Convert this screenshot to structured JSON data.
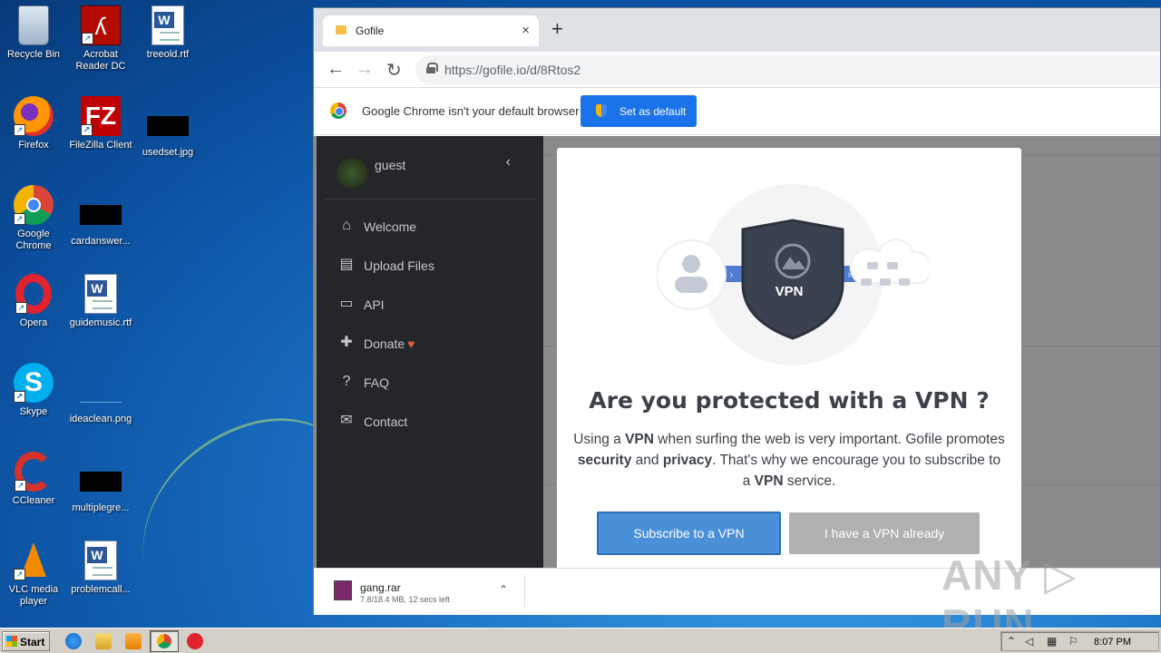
{
  "desktop": {
    "icons": [
      {
        "label": "Recycle Bin"
      },
      {
        "label": "Acrobat\nReader DC"
      },
      {
        "label": "treeold.rtf"
      },
      {
        "label": "Firefox"
      },
      {
        "label": "FileZilla Client"
      },
      {
        "label": "usedset.jpg"
      },
      {
        "label": "Google\nChrome"
      },
      {
        "label": "cardanswer..."
      },
      {
        "label": "Opera"
      },
      {
        "label": "guidemusic.rtf"
      },
      {
        "label": "Skype"
      },
      {
        "label": "ideaclean.png"
      },
      {
        "label": "CCleaner"
      },
      {
        "label": "multiplegre..."
      },
      {
        "label": "VLC media\nplayer"
      },
      {
        "label": "problemcall..."
      }
    ]
  },
  "browser": {
    "tab_title": "Gofile",
    "close_glyph": "×",
    "newtab_glyph": "+",
    "nav": {
      "back": "←",
      "forward": "→",
      "reload": "↻"
    },
    "url": "https://gofile.io/d/8Rtos2",
    "infobar": {
      "message": "Google Chrome isn't your default browser",
      "button": "Set as default"
    }
  },
  "gofile": {
    "user": {
      "name": "guest",
      "collapse_glyph": "‹"
    },
    "menu": [
      {
        "icon": "home-icon",
        "glyph": "⌂",
        "label": "Welcome"
      },
      {
        "icon": "upload-file-icon",
        "glyph": "▤",
        "label": "Upload Files"
      },
      {
        "icon": "api-icon",
        "glyph": "▭",
        "label": "API"
      },
      {
        "icon": "gift-icon",
        "glyph": "✚",
        "label": "Donate",
        "suffix": "♥"
      },
      {
        "icon": "question-icon",
        "glyph": "?",
        "label": "FAQ"
      },
      {
        "icon": "envelope-icon",
        "glyph": "✉",
        "label": "Contact"
      }
    ],
    "modal": {
      "shield_text": "VPN",
      "title": "Are you protected with a VPN ?",
      "desc_1": "Using a ",
      "desc_vpn": "VPN",
      "desc_2": " when surfing the web is very important. Gofile promotes ",
      "desc_security": "security",
      "desc_3": " and ",
      "desc_privacy": "privacy",
      "desc_4": ". That's why we encourage you to subscribe to a ",
      "desc_vpn2": "VPN",
      "desc_5": " service.",
      "btn_subscribe": "Subscribe to a VPN",
      "btn_have": "I have a VPN already"
    }
  },
  "downloads": {
    "file": "gang.rar",
    "status": "7.8/18.4 MB, 12 secs left",
    "caret": "⌃"
  },
  "watermark": "ANY ▷ RUN",
  "taskbar": {
    "start": "Start",
    "clock": "8:07 PM"
  },
  "colors": {
    "accent": "#1a73e8",
    "sidebar": "#24262a",
    "subscribe": "#4a90d9",
    "have_vpn": "#b0b0b0"
  }
}
